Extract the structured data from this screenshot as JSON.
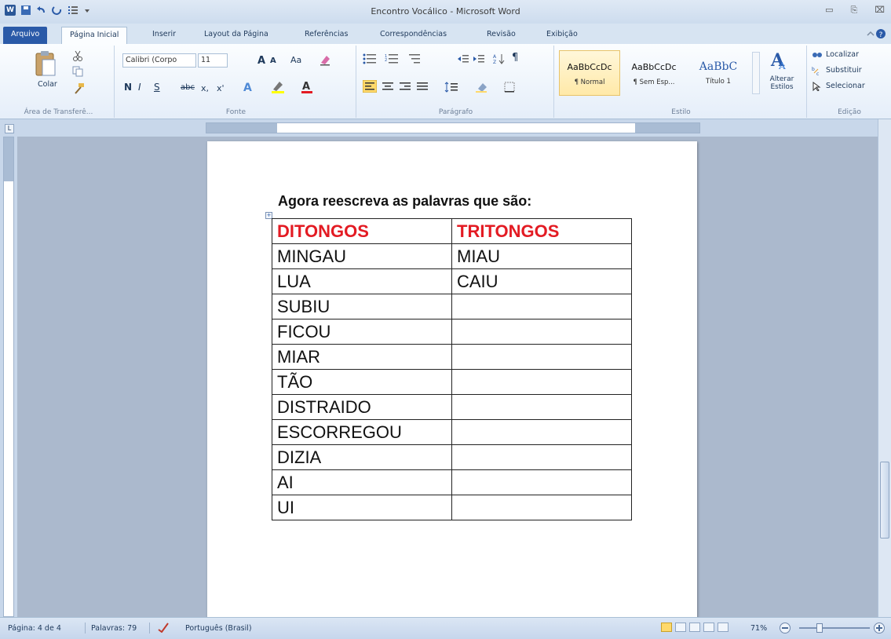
{
  "window": {
    "title": "Encontro Vocálico - Microsoft Word",
    "controls": [
      "▭",
      "⎘",
      "⌧"
    ]
  },
  "qat": {
    "app_icon": "W"
  },
  "tabs": [
    {
      "label": "Arquivo"
    },
    {
      "label": "Página Inicial"
    },
    {
      "label": "Inserir"
    },
    {
      "label": "Layout da Página"
    },
    {
      "label": "Referências"
    },
    {
      "label": "Correspondências"
    },
    {
      "label": "Revisão"
    },
    {
      "label": "Exibição"
    }
  ],
  "ribbon": {
    "clipboard": {
      "paste_label": "Colar",
      "group_label": "Área de Transferê..."
    },
    "font": {
      "font_name": "Calibri (Corpo",
      "font_size": "11",
      "grow": "A",
      "shrink": "A",
      "case": "Aa",
      "bold": "N",
      "italic": "I",
      "underline": "S",
      "strike": "abc",
      "subscript": "x,",
      "superscript": "x'",
      "group_label": "Fonte"
    },
    "paragraph": {
      "group_label": "Parágrafo",
      "pilcrow": "¶"
    },
    "styles": {
      "items": [
        {
          "sample": "AaBbCcDc",
          "name": "¶ Normal"
        },
        {
          "sample": "AaBbCcDc",
          "name": "¶ Sem Esp..."
        },
        {
          "sample": "AaBbC",
          "name": "Título 1"
        }
      ],
      "change_label": "Alterar Estilos",
      "group_label": "Estilo"
    },
    "editing": {
      "find": "Localizar",
      "replace": "Substituir",
      "select": "Selecionar",
      "group_label": "Edição"
    }
  },
  "document": {
    "heading": "Agora reescreva as palavras que são:",
    "table": {
      "headers": [
        "DITONGOS",
        "TRITONGOS"
      ],
      "rows": [
        [
          "MINGAU",
          "MIAU"
        ],
        [
          "LUA",
          "CAIU"
        ],
        [
          "SUBIU",
          ""
        ],
        [
          "FICOU",
          ""
        ],
        [
          "MIAR",
          ""
        ],
        [
          "TÃO",
          ""
        ],
        [
          "DISTRAIDO",
          ""
        ],
        [
          "ESCORREGOU",
          ""
        ],
        [
          "DIZIA",
          ""
        ],
        [
          "AI",
          ""
        ],
        [
          "UI",
          ""
        ]
      ]
    }
  },
  "status": {
    "page": "Página: 4 de 4",
    "words": "Palavras: 79",
    "language": "Português (Brasil)",
    "zoom": "71%"
  },
  "colors": {
    "header_red": "#e31b23",
    "file_tab_blue": "#2a5aa8"
  }
}
